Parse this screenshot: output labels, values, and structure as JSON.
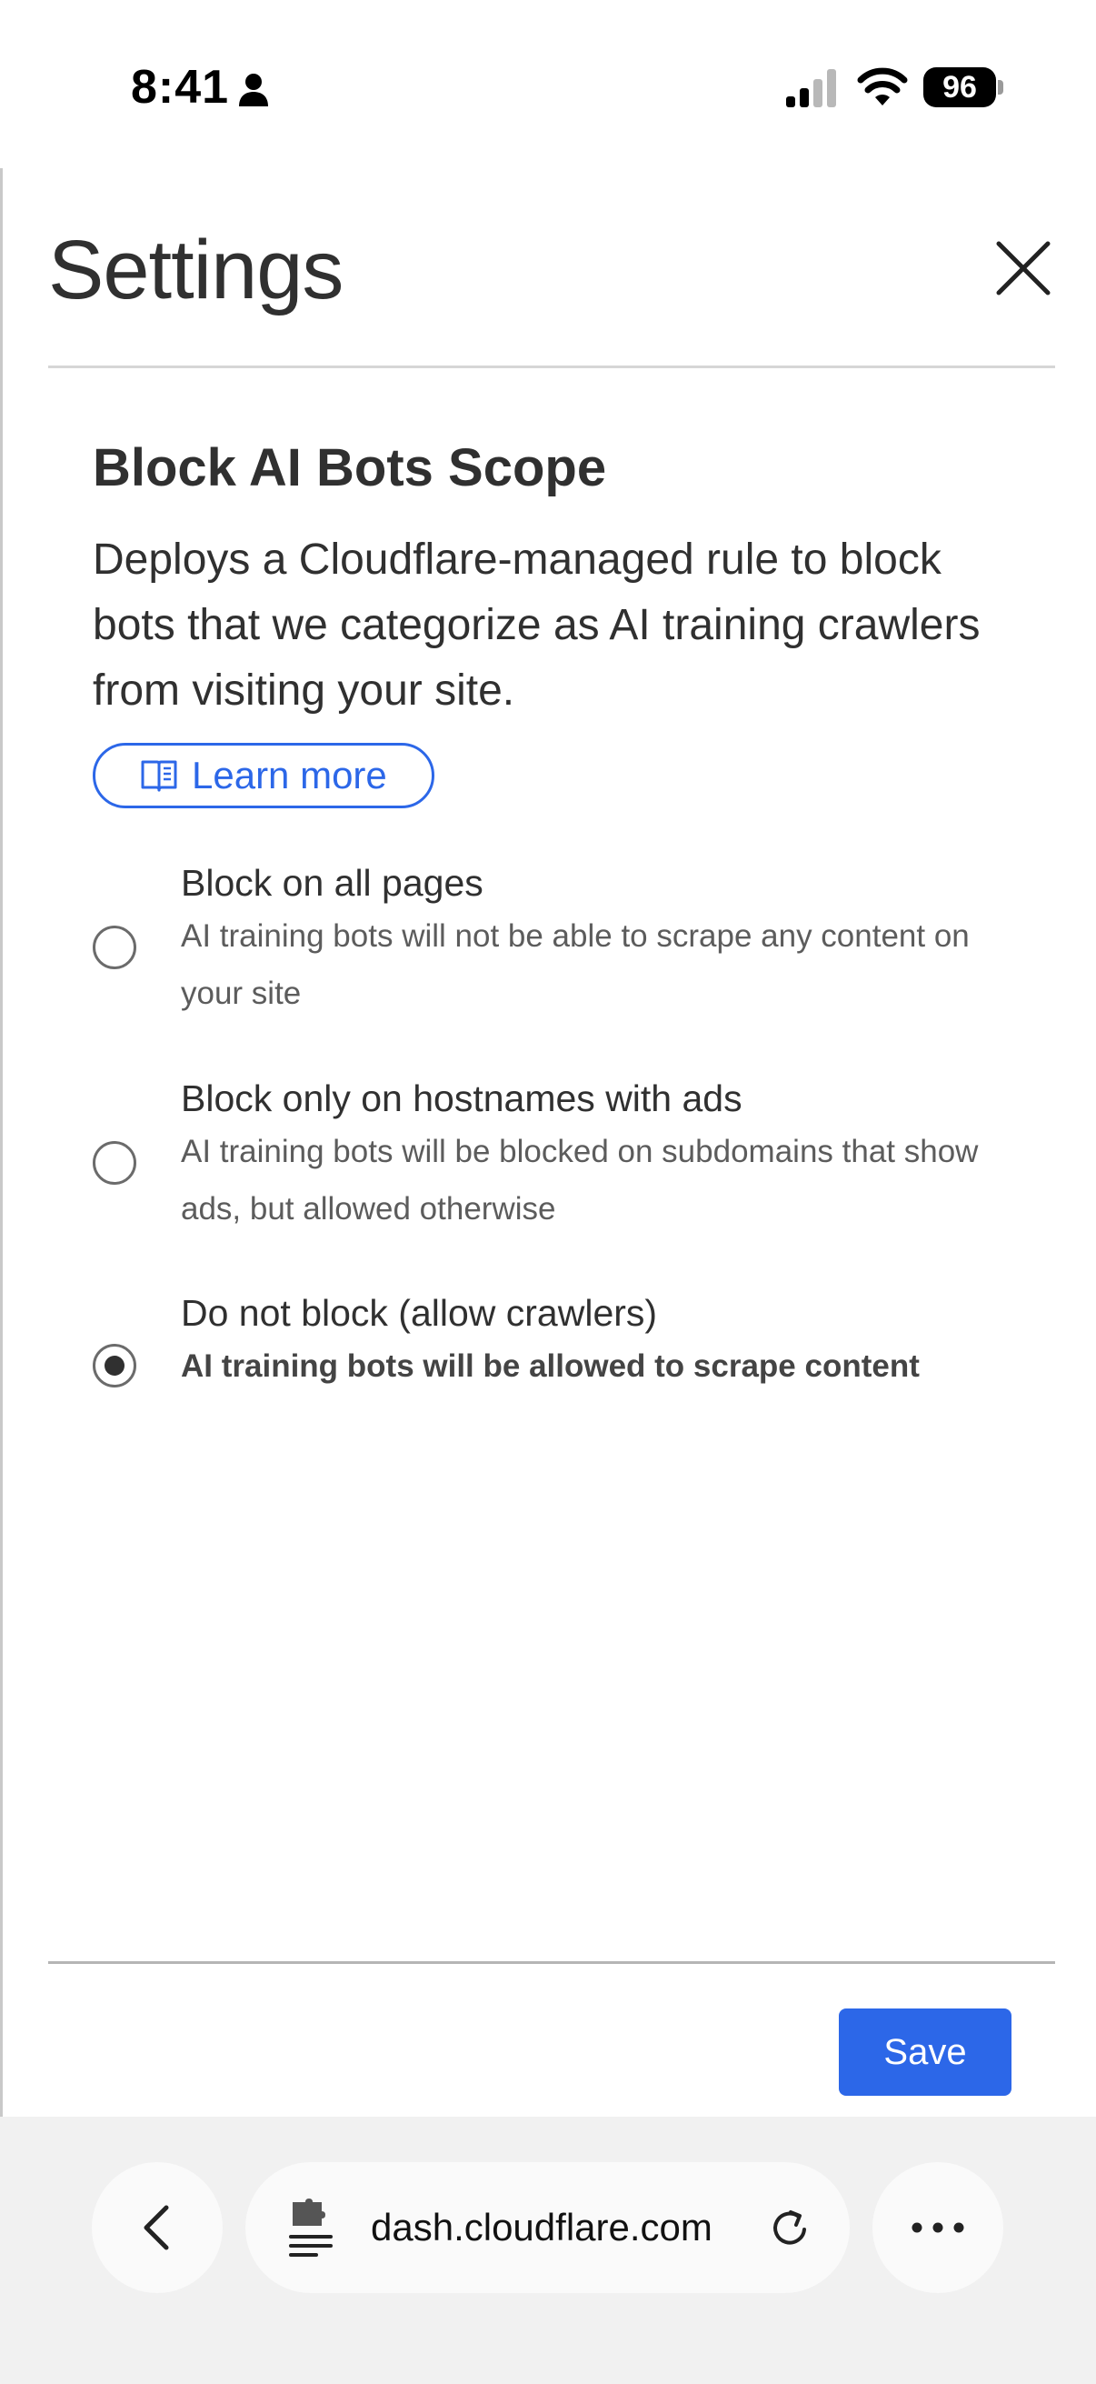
{
  "status_bar": {
    "time": "8:41",
    "battery": "96",
    "icons": [
      "person-icon",
      "signal-icon",
      "wifi-icon",
      "battery-icon"
    ]
  },
  "panel": {
    "title": "Settings",
    "close_icon": "close-icon"
  },
  "section": {
    "heading": "Block AI Bots Scope",
    "description": "Deploys a Cloudflare-managed rule to block bots that we categorize as AI training crawlers from visiting your site.",
    "learn_more": "Learn more",
    "learn_more_icon": "book-icon"
  },
  "options": [
    {
      "label": "Block on all pages",
      "description": "AI training bots will not be able to scrape any content on your site",
      "selected": false
    },
    {
      "label": "Block only on hostnames with ads",
      "description": "AI training bots will be blocked on subdomains that show ads, but allowed otherwise",
      "selected": false
    },
    {
      "label": "Do not block (allow crawlers)",
      "description": "AI training bots will be allowed to scrape content",
      "selected": true
    }
  ],
  "footer": {
    "save_label": "Save"
  },
  "browser": {
    "url": "dash.cloudflare.com",
    "icons": [
      "back-icon",
      "extension-icon",
      "reload-icon",
      "more-icon"
    ]
  },
  "colors": {
    "accent": "#2c67e8",
    "text": "#303030",
    "muted": "#5c5c5c"
  }
}
